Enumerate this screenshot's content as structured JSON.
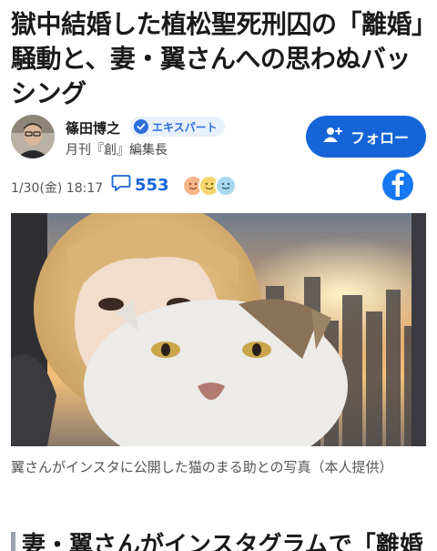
{
  "article": {
    "title": "獄中結婚した植松聖死刑囚の「離婚」騒動と、妻・翼さんへの思わぬバッシング"
  },
  "author": {
    "name": "篠田博之",
    "badge": "エキスパート",
    "affiliation": "月刊『創』編集長",
    "avatar_icon": "author-portrait"
  },
  "follow": {
    "label": "フォロー",
    "icon": "person-add-icon"
  },
  "meta": {
    "date": "1/30(金) 18:17",
    "comment_count": "553",
    "comment_icon": "speech-bubble-icon",
    "reaction_icons": [
      "smile-orange",
      "smile-yellow",
      "smile-blue"
    ],
    "share_icon": "facebook-icon"
  },
  "photo": {
    "caption": "翼さんがインスタに公開した猫のまる助との写真（本人提供）"
  },
  "section": {
    "heading": "妻・翼さんがインスタグラムで「離婚"
  },
  "colors": {
    "accent": "#1565d8",
    "facebook": "#1877f2",
    "badge_bg": "#e8f0fb"
  }
}
